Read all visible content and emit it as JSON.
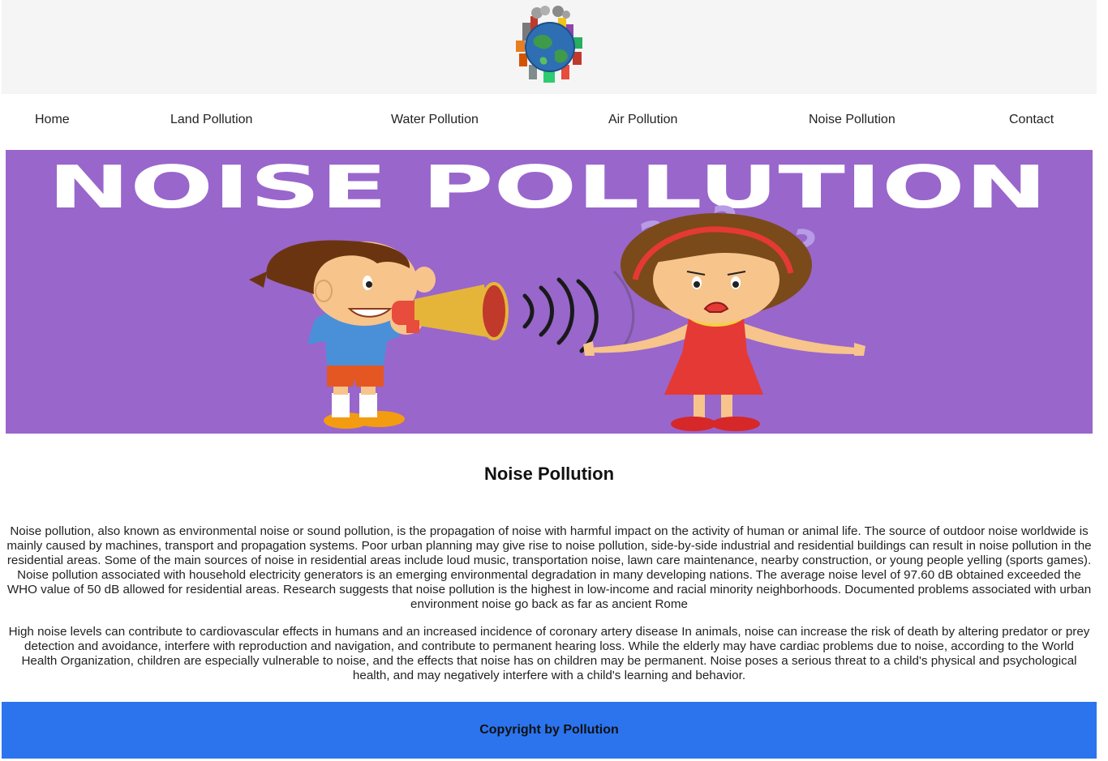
{
  "nav": {
    "items": [
      {
        "label": "Home"
      },
      {
        "label": "Land Pollution"
      },
      {
        "label": "Water Pollution"
      },
      {
        "label": "Air Pollution"
      },
      {
        "label": "Noise Pollution"
      },
      {
        "label": "Contact"
      }
    ]
  },
  "banner": {
    "title": "NOISE POLLUTION",
    "question_mark": "?",
    "background_color": "#9966cc"
  },
  "main": {
    "heading": "Noise Pollution",
    "paragraphs": [
      "Noise pollution, also known as environmental noise or sound pollution, is the propagation of noise with harmful impact on the activity of human or animal life. The source of outdoor noise worldwide is mainly caused by machines, transport and propagation systems. Poor urban planning may give rise to noise pollution, side-by-side industrial and residential buildings can result in noise pollution in the residential areas. Some of the main sources of noise in residential areas include loud music, transportation noise, lawn care maintenance, nearby construction, or young people yelling (sports games). Noise pollution associated with household electricity generators is an emerging environmental degradation in many developing nations. The average noise level of 97.60 dB obtained exceeded the WHO value of 50 dB allowed for residential areas. Research suggests that noise pollution is the highest in low-income and racial minority neighborhoods. Documented problems associated with urban environment noise go back as far as ancient Rome",
      "High noise levels can contribute to cardiovascular effects in humans and an increased incidence of coronary artery disease In animals, noise can increase the risk of death by altering predator or prey detection and avoidance, interfere with reproduction and navigation, and contribute to permanent hearing loss. While the elderly may have cardiac problems due to noise, according to the World Health Organization, children are especially vulnerable to noise, and the effects that noise has on children may be permanent. Noise poses a serious threat to a child's physical and psychological health, and may negatively interfere with a child's learning and behavior."
    ]
  },
  "footer": {
    "text": "Copyright by Pollution",
    "background_color": "#2b74ee"
  },
  "icons": {
    "logo": "globe-pollution-logo-icon"
  }
}
